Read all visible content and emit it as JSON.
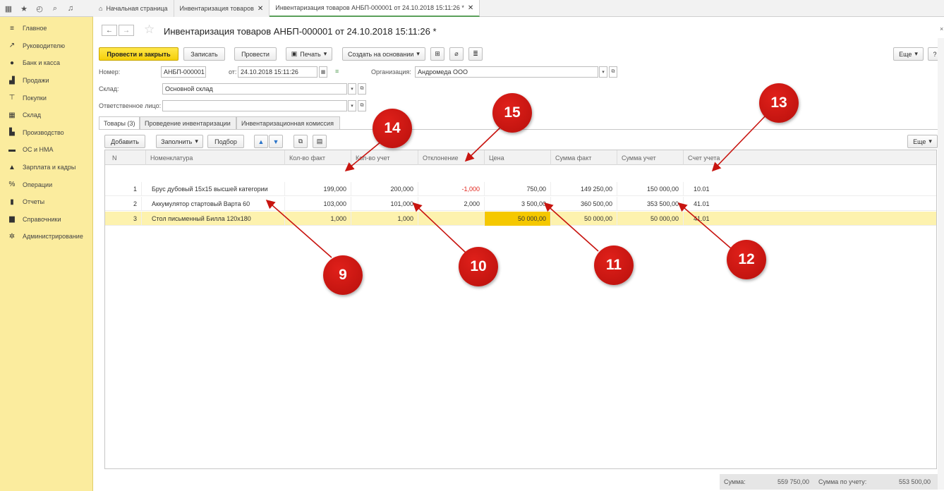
{
  "topbar": {
    "tabs": [
      {
        "label": "Начальная страница"
      },
      {
        "label": "Инвентаризация товаров"
      },
      {
        "label": "Инвентаризация товаров АНБП-000001 от 24.10.2018 15:11:26 *"
      }
    ]
  },
  "sidebar": {
    "items": [
      {
        "label": "Главное",
        "icon": "menu-icon"
      },
      {
        "label": "Руководителю",
        "icon": "chart-line-icon"
      },
      {
        "label": "Банк и касса",
        "icon": "coin-icon"
      },
      {
        "label": "Продажи",
        "icon": "bag-icon"
      },
      {
        "label": "Покупки",
        "icon": "cart-icon"
      },
      {
        "label": "Склад",
        "icon": "warehouse-icon"
      },
      {
        "label": "Производство",
        "icon": "factory-icon"
      },
      {
        "label": "ОС и НМА",
        "icon": "truck-icon"
      },
      {
        "label": "Зарплата и кадры",
        "icon": "person-icon"
      },
      {
        "label": "Операции",
        "icon": "operations-icon"
      },
      {
        "label": "Отчеты",
        "icon": "bar-chart-icon"
      },
      {
        "label": "Справочники",
        "icon": "book-icon"
      },
      {
        "label": "Администрирование",
        "icon": "gear-icon"
      }
    ]
  },
  "form": {
    "title": "Инвентаризация товаров АНБП-000001 от 24.10.2018 15:11:26 *",
    "toolbar": {
      "post_close": "Провести и закрыть",
      "save": "Записать",
      "post": "Провести",
      "print": "Печать",
      "create_based": "Создать на основании",
      "more": "Еще",
      "help": "?"
    },
    "number_label": "Номер:",
    "number_value": "АНБП-000001",
    "date_label": "от:",
    "date_value": "24.10.2018 15:11:26",
    "org_label": "Организация:",
    "org_value": "Андромеда ООО",
    "warehouse_label": "Склад:",
    "warehouse_value": "Основной склад",
    "responsible_label": "Ответственное лицо:",
    "responsible_value": "",
    "tabs": [
      {
        "label": "Товары (3)"
      },
      {
        "label": "Проведение инвентаризации"
      },
      {
        "label": "Инвентаризационная комиссия"
      }
    ],
    "table_toolbar": {
      "add": "Добавить",
      "fill": "Заполнить",
      "select": "Подбор",
      "more": "Еще"
    }
  },
  "table": {
    "columns": [
      "N",
      "Номенклатура",
      "Кол-во факт",
      "Кол-во учет",
      "Отклонение",
      "Цена",
      "Сумма факт",
      "Сумма учет",
      "Счет учета"
    ],
    "rows": [
      {
        "n": "1",
        "name": "Брус дубовый 15x15 высшей категории",
        "qty_fact": "199,000",
        "qty_acc": "200,000",
        "dev": "-1,000",
        "price": "750,00",
        "sum_fact": "149 250,00",
        "sum_acc": "150 000,00",
        "account": "10.01"
      },
      {
        "n": "2",
        "name": "Аккумулятор стартовый Варта 60",
        "qty_fact": "103,000",
        "qty_acc": "101,000",
        "dev": "2,000",
        "price": "3 500,00",
        "sum_fact": "360 500,00",
        "sum_acc": "353 500,00",
        "account": "41.01"
      },
      {
        "n": "3",
        "name": "Стол письменный Билла 120x180",
        "qty_fact": "1,000",
        "qty_acc": "1,000",
        "dev": "",
        "price": "50 000,00",
        "sum_fact": "50 000,00",
        "sum_acc": "50 000,00",
        "account": "41.01"
      }
    ]
  },
  "footer": {
    "sum_label": "Сумма:",
    "sum_value": "559 750,00",
    "sum_acc_label": "Сумма по учету:",
    "sum_acc_value": "553 500,00"
  },
  "callouts": [
    "9",
    "10",
    "11",
    "12",
    "13",
    "14",
    "15"
  ],
  "colors": {
    "sidebar": "#fbec9e",
    "primary_button": "#f5cf0a",
    "selected_row": "#fdf2ae",
    "highlight_cell": "#f5c800",
    "callout": "#c8140f",
    "negative": "#e0241c"
  }
}
